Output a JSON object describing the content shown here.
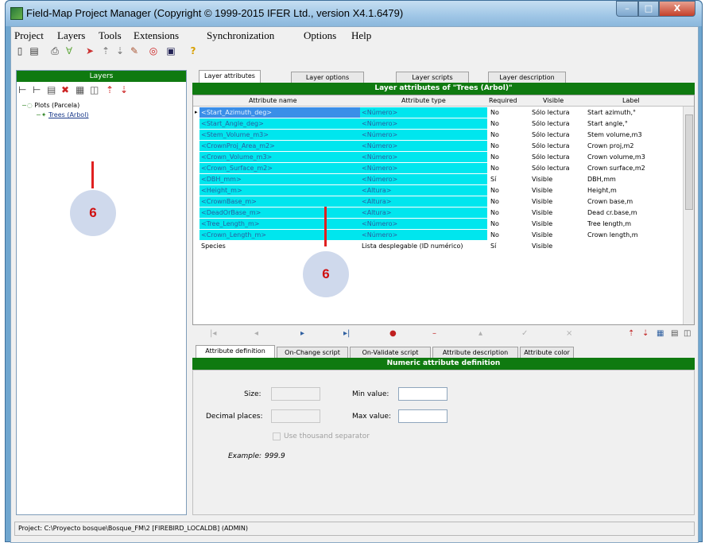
{
  "window": {
    "title": "Field-Map Project Manager (Copyright © 1999-2015 IFER Ltd., version X4.1.6479)",
    "min_label": "–",
    "max_label": "□",
    "close_label": "X"
  },
  "menu": [
    "Project",
    "Layers",
    "Tools",
    "Extensions",
    "Synchronization",
    "Options",
    "Help"
  ],
  "toolbar_icons": [
    "new-icon",
    "open-icon",
    "print-icon",
    "filter-icon",
    "arrow-icon",
    "move-up-icon",
    "move-down-icon",
    "pen-icon",
    "target-icon",
    "database-icon",
    "help-icon"
  ],
  "left_panel": {
    "title": "Layers",
    "tree": [
      {
        "label": "Plots (Parcela)",
        "level": 0
      },
      {
        "label": "Trees (Arbol)",
        "level": 1
      }
    ]
  },
  "top_tabs": [
    "Layer attributes",
    "Layer options",
    "Layer scripts",
    "Layer description"
  ],
  "grid": {
    "title": "Layer attributes of \"Trees (Arbol)\"",
    "columns": [
      "Attribute name",
      "Attribute type",
      "Required",
      "Visible",
      "Label"
    ],
    "rows": [
      {
        "name": "<Start_Azimuth_deg>",
        "type": "<Número>",
        "required": "No",
        "visible": "Sólo lectura",
        "label": "Start azimuth,°"
      },
      {
        "name": "<Start_Angle_deg>",
        "type": "<Número>",
        "required": "No",
        "visible": "Sólo lectura",
        "label": "Start angle,°"
      },
      {
        "name": "<Stem_Volume_m3>",
        "type": "<Número>",
        "required": "No",
        "visible": "Sólo lectura",
        "label": "Stem volume,m3"
      },
      {
        "name": "<CrownProj_Area_m2>",
        "type": "<Número>",
        "required": "No",
        "visible": "Sólo lectura",
        "label": "Crown proj,m2"
      },
      {
        "name": "<Crown_Volume_m3>",
        "type": "<Número>",
        "required": "No",
        "visible": "Sólo lectura",
        "label": "Crown volume,m3"
      },
      {
        "name": "<Crown_Surface_m2>",
        "type": "<Número>",
        "required": "No",
        "visible": "Sólo lectura",
        "label": "Crown surface,m2"
      },
      {
        "name": "<DBH_mm>",
        "type": "<Número>",
        "required": "Sí",
        "visible": "Visible",
        "label": "DBH,mm"
      },
      {
        "name": "<Height_m>",
        "type": "<Altura>",
        "required": "No",
        "visible": "Visible",
        "label": "Height,m"
      },
      {
        "name": "<CrownBase_m>",
        "type": "<Altura>",
        "required": "No",
        "visible": "Visible",
        "label": "Crown base,m"
      },
      {
        "name": "<DeadOrBase_m>",
        "type": "<Altura>",
        "required": "No",
        "visible": "Visible",
        "label": "Dead cr.base,m"
      },
      {
        "name": "<Tree_Length_m>",
        "type": "<Número>",
        "required": "No",
        "visible": "Visible",
        "label": "Tree length,m"
      },
      {
        "name": "<Crown_Length_m>",
        "type": "<Número>",
        "required": "No",
        "visible": "Visible",
        "label": "Crown length,m"
      },
      {
        "name": "Species",
        "type": "Lista desplegable (ID numérico)",
        "required": "Sí",
        "visible": "Visible",
        "label": ""
      }
    ]
  },
  "nav": {
    "first": "|◂",
    "prev": "◂",
    "next": "▸",
    "last": "▸|",
    "add": "●",
    "delete": "–",
    "up": "▴",
    "confirm": "✓",
    "cancel": "×"
  },
  "bottom_tabs": [
    "Attribute definition",
    "On-Change script",
    "On-Validate script",
    "Attribute description",
    "Attribute color"
  ],
  "definition": {
    "title": "Numeric attribute definition",
    "size_label": "Size:",
    "decimal_label": "Decimal places:",
    "min_label": "Min value:",
    "max_label": "Max value:",
    "thousand_label": "Use thousand separator",
    "example_label": "Example:",
    "example_value": "999.9"
  },
  "status": "Project: C:\\Proyecto bosque\\Bosque_FM\\2 [FIREBIRD_LOCALDB] (ADMIN)",
  "annotations": [
    "6",
    "6"
  ]
}
